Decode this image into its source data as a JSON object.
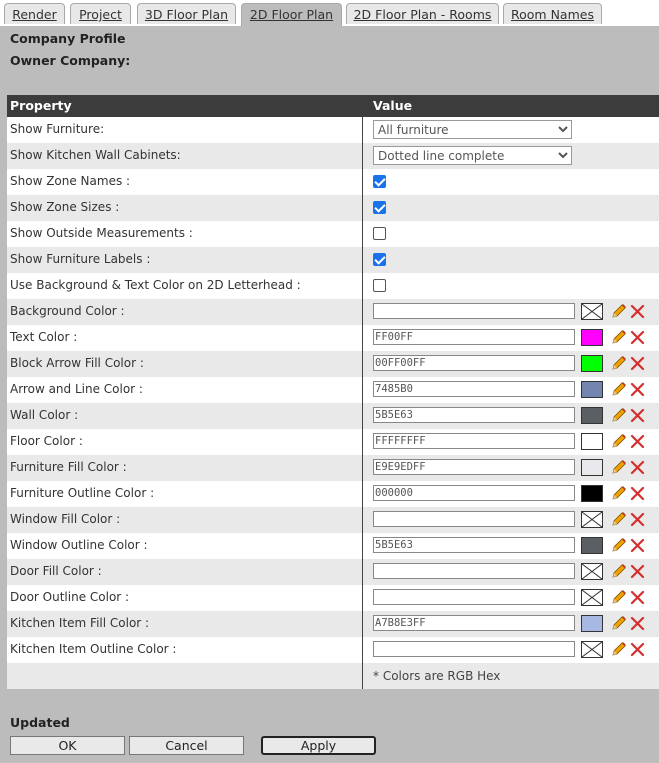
{
  "tabs": [
    "Render",
    "Project",
    "3D Floor Plan",
    "2D Floor Plan",
    "2D Floor Plan - Rooms",
    "Room Names"
  ],
  "active_tab": "2D Floor Plan",
  "company_profile_label": "Company Profile",
  "owner_company_label": "Owner Company:",
  "table": {
    "col_property": "Property",
    "col_value": "Value",
    "selects": [
      {
        "label": "Show Furniture:",
        "value": "All furniture"
      },
      {
        "label": "Show Kitchen Wall Cabinets:",
        "value": "Dotted line complete"
      }
    ],
    "checkboxes": [
      {
        "label": "Show Zone Names :",
        "checked": true
      },
      {
        "label": "Show Zone Sizes :",
        "checked": true
      },
      {
        "label": "Show Outside Measurements :",
        "checked": false
      },
      {
        "label": "Show Furniture Labels :",
        "checked": true
      },
      {
        "label": "Use Background & Text Color on 2D Letterhead :",
        "checked": false
      }
    ],
    "colors": [
      {
        "label": "Background Color :",
        "value": "",
        "swatch": null
      },
      {
        "label": "Text Color :",
        "value": "FF00FF",
        "swatch": "#FF00FF"
      },
      {
        "label": "Block Arrow Fill Color :",
        "value": "00FF00FF",
        "swatch": "#00FF00"
      },
      {
        "label": "Arrow and Line Color :",
        "value": "7485B0",
        "swatch": "#7485B0"
      },
      {
        "label": "Wall Color :",
        "value": "5B5E63",
        "swatch": "#5B5E63"
      },
      {
        "label": "Floor Color :",
        "value": "FFFFFFFF",
        "swatch": "#FFFFFF"
      },
      {
        "label": "Furniture Fill Color :",
        "value": "E9E9EDFF",
        "swatch": "#E9E9ED"
      },
      {
        "label": "Furniture Outline Color :",
        "value": "000000",
        "swatch": "#000000"
      },
      {
        "label": "Window Fill Color :",
        "value": "",
        "swatch": null
      },
      {
        "label": "Window Outline Color :",
        "value": "5B5E63",
        "swatch": "#5B5E63"
      },
      {
        "label": "Door Fill Color :",
        "value": "",
        "swatch": null
      },
      {
        "label": "Door Outline Color :",
        "value": "",
        "swatch": null
      },
      {
        "label": "Kitchen Item Fill Color :",
        "value": "A7B8E3FF",
        "swatch": "#A7B8E3"
      },
      {
        "label": "Kitchen Item Outline Color :",
        "value": "",
        "swatch": null
      }
    ],
    "note": "* Colors are RGB Hex"
  },
  "status": "Updated",
  "buttons": {
    "ok": "OK",
    "cancel": "Cancel",
    "apply": "Apply"
  },
  "colors": {
    "header_bg": "#3C3C3C",
    "panel_bg": "#BCBCBC",
    "row_alt": "#E9E9E9",
    "checkbox": "#1A73E8",
    "delete": "#D32F2F"
  }
}
